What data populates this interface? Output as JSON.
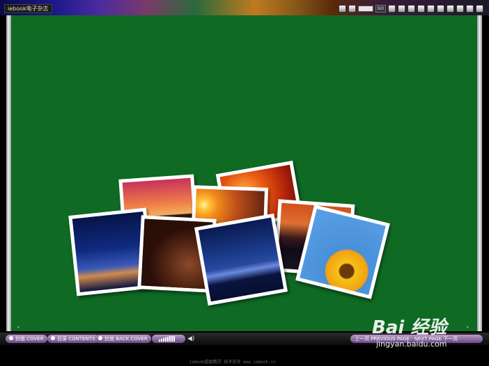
{
  "window": {
    "title": "iebook电子杂志"
  },
  "toolbar": {
    "go_label": "GO",
    "icons": [
      "book-icon",
      "zoom-icon",
      "page-input",
      "go-button",
      "print-icon",
      "save-icon",
      "share-icon",
      "email-icon",
      "settings-icon",
      "help-icon",
      "fullscreen-icon",
      "minimize-icon",
      "restore-icon",
      "close-icon"
    ]
  },
  "book": {
    "background_color": "#0f6a24",
    "photos": [
      "sunset-city",
      "sun-over-clouds",
      "red-flowers",
      "night-beach",
      "horse",
      "night-harbor",
      "dusk-city",
      "sunflower"
    ],
    "left_marker": "◂",
    "right_marker": "▸"
  },
  "bottom_nav": {
    "cover_label": "封面 COVER",
    "contents_label": "目录 CONTENTS",
    "back_cover_label": "封底 BACK COVER",
    "volume_level": 0.7,
    "prev_next_label": "上一页 PREVIOUS PAGE · NEXT PAGE 下一页"
  },
  "footer": {
    "text": "iebook超级精灵·技术支持 www.iebook.cn"
  },
  "watermark": {
    "logo_text": "Bai 经验",
    "url": "jingyan.baidu.com"
  }
}
